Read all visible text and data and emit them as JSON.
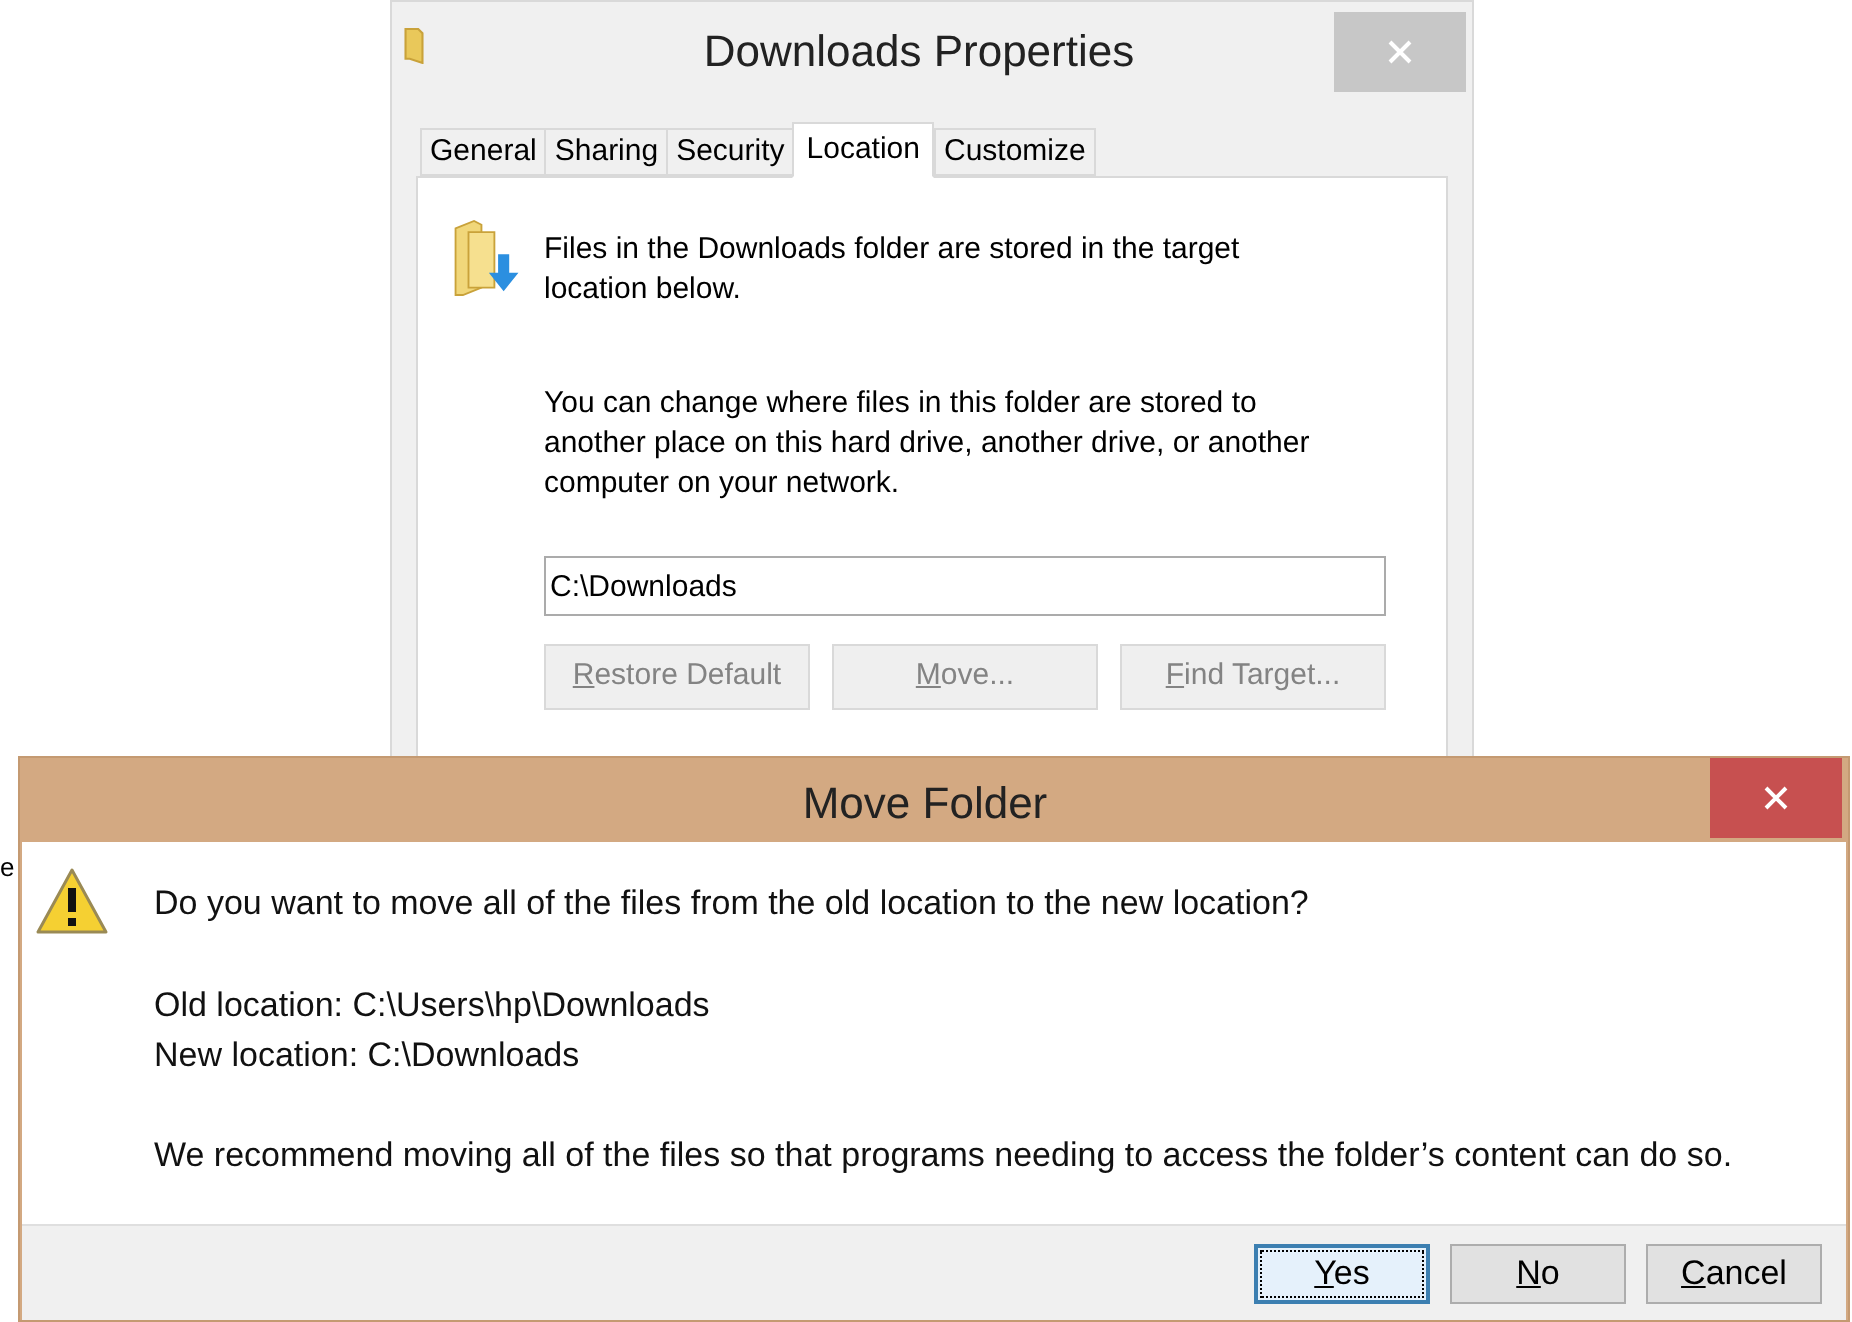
{
  "background_fragment": "e",
  "properties_window": {
    "title": "Downloads Properties",
    "tabs": [
      {
        "label": "General",
        "selected": false
      },
      {
        "label": "Sharing",
        "selected": false
      },
      {
        "label": "Security",
        "selected": false
      },
      {
        "label": "Location",
        "selected": true
      },
      {
        "label": "Customize",
        "selected": false
      }
    ],
    "info_text": "Files in the Downloads folder are stored in the target location below.",
    "description": "You can change where files in this folder are stored to another place on this hard drive, another drive, or another computer on your network.",
    "path_field": {
      "value": "C:\\Downloads"
    },
    "buttons": [
      {
        "label": "Restore Default",
        "disabled": true
      },
      {
        "label": "Move...",
        "disabled": true
      },
      {
        "label": "Find Target...",
        "disabled": true
      }
    ]
  },
  "dialog": {
    "title": "Move Folder",
    "question": "Do you want to move all of the files from the old location to the new location?",
    "old_location": "Old location: C:\\Users\\hp\\Downloads",
    "new_location": "New location: C:\\Downloads",
    "recommendation": "We recommend moving all of the files so that programs needing to access the folder’s content can do so.",
    "buttons": [
      {
        "label": "Yes",
        "default": true
      },
      {
        "label": "No",
        "default": false
      },
      {
        "label": "Cancel",
        "default": false
      }
    ]
  }
}
